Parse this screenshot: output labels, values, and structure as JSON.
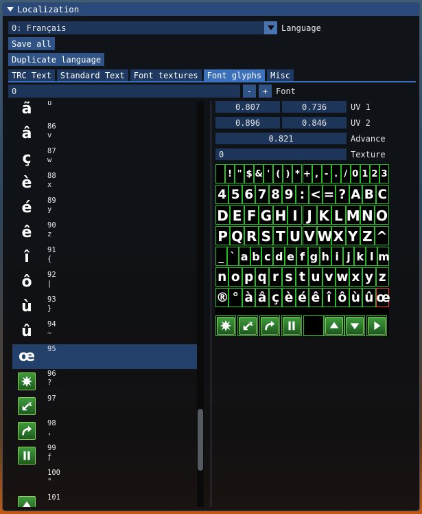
{
  "window": {
    "title": "Localization"
  },
  "language": {
    "value": "0: Français",
    "label": "Language"
  },
  "buttons": {
    "save_all": "Save all",
    "duplicate": "Duplicate language"
  },
  "tabs": [
    "TRC Text",
    "Standard Text",
    "Font textures",
    "Font glyphs",
    "Misc"
  ],
  "active_tab": "Font glyphs",
  "font": {
    "value": "0",
    "minus": "-",
    "plus": "+",
    "label": "Font"
  },
  "glyph_list": [
    {
      "glyph": "ã",
      "num": "",
      "ch": "u"
    },
    {
      "glyph": "â",
      "num": "86",
      "ch": "v"
    },
    {
      "glyph": "ç",
      "num": "87",
      "ch": "w"
    },
    {
      "glyph": "è",
      "num": "88",
      "ch": "x"
    },
    {
      "glyph": "é",
      "num": "89",
      "ch": "y"
    },
    {
      "glyph": "ê",
      "num": "90",
      "ch": "z"
    },
    {
      "glyph": "î",
      "num": "91",
      "ch": "{"
    },
    {
      "glyph": "ô",
      "num": "92",
      "ch": "|"
    },
    {
      "glyph": "ù",
      "num": "93",
      "ch": "}"
    },
    {
      "glyph": "û",
      "num": "94",
      "ch": "~"
    },
    {
      "glyph": "œ",
      "num": "95",
      "ch": ""
    },
    {
      "icon": "burst-icon",
      "num": "96",
      "ch": "?"
    },
    {
      "icon": "explode-arrow-icon",
      "num": "97",
      "ch": ""
    },
    {
      "icon": "curve-arrow-icon",
      "num": "98",
      "ch": ","
    },
    {
      "icon": "pause-icon",
      "num": "99",
      "ch": "ƒ"
    },
    {
      "icon": "",
      "num": "100",
      "ch": "\""
    },
    {
      "icon": "up-arrow-icon",
      "num": "101",
      "ch": "…"
    }
  ],
  "selected_index": 10,
  "uv1": {
    "u": "0.807",
    "v": "0.736",
    "label": "UV 1"
  },
  "uv2": {
    "u": "0.896",
    "v": "0.846",
    "label": "UV 2"
  },
  "advance": {
    "value": "0.821",
    "label": "Advance"
  },
  "texture": {
    "value": "0",
    "label": "Texture"
  },
  "atlas_rows": [
    [
      " ",
      "!",
      "\"",
      "$",
      "&",
      "'",
      "(",
      ")",
      "*",
      "+",
      ",",
      "-",
      ".",
      "/",
      "0",
      "1",
      "2",
      "3"
    ],
    [
      "4",
      "5",
      "6",
      "7",
      "8",
      "9",
      ":",
      "<",
      "=",
      "?",
      "A",
      "B",
      "C"
    ],
    [
      "D",
      "E",
      "F",
      "G",
      "H",
      "I",
      "J",
      "K",
      "L",
      "M",
      "N",
      "O"
    ],
    [
      "P",
      "Q",
      "R",
      "S",
      "T",
      "U",
      "V",
      "W",
      "X",
      "Y",
      "Z",
      "^"
    ],
    [
      "_",
      "`",
      "a",
      "b",
      "c",
      "d",
      "e",
      "f",
      "g",
      "h",
      "i",
      "j",
      "k",
      "l",
      "m"
    ],
    [
      "n",
      "o",
      "p",
      "q",
      "r",
      "s",
      "t",
      "u",
      "v",
      "w",
      "x",
      "y",
      "z"
    ],
    [
      "®",
      "°",
      "à",
      "â",
      "ç",
      "è",
      "é",
      "ê",
      "î",
      "ô",
      "ù",
      "û",
      "œ"
    ]
  ],
  "atlas_icons": [
    "burst-icon",
    "explode-arrow-icon",
    "curve-arrow-icon",
    "pause-icon",
    "",
    "up-arrow-icon",
    "down-arrow-icon",
    "right-arrow-icon"
  ],
  "colors": {
    "accent": "#3b70bd",
    "frame": "#294a7a",
    "glyph_border": "#22c222",
    "selected_border": "#ff3030"
  }
}
